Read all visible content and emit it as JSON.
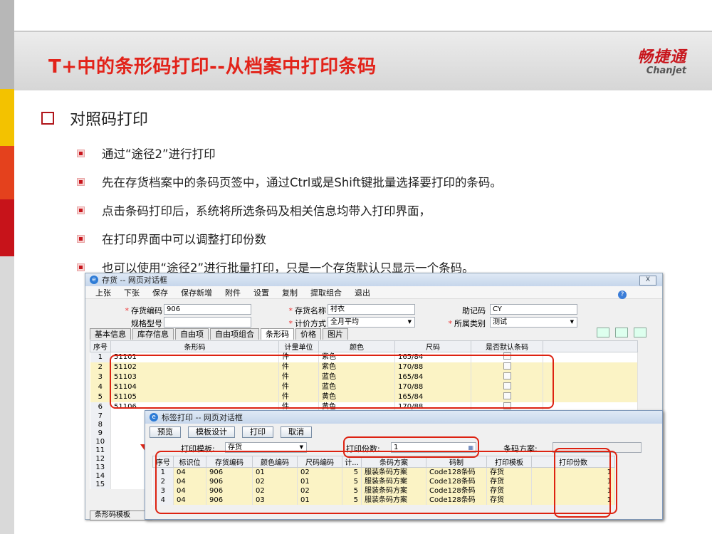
{
  "slide": {
    "title": "T+中的条形码打印--从档案中打印条码",
    "logo_cn": "畅捷通",
    "logo_en": "Chanjet",
    "heading": "对照码打印",
    "bullets": [
      "通过“途径2”进行打印",
      "先在存货档案中的条码页签中，通过Ctrl或是Shift键批量选择要打印的条码。",
      "点击条码打印后，系统将所选条码及相关信息均带入打印界面，",
      "在打印界面中可以调整打印份数",
      "也可以使用“途径2”进行批量打印，只是一个存货默认只显示一个条码。"
    ],
    "accent": "#e2231a"
  },
  "win1": {
    "title": "存货 -- 网页对话框",
    "close": "X",
    "menu": [
      "上张",
      "下张",
      "保存",
      "保存新增",
      "附件",
      "设置",
      "复制",
      "提取组合",
      "退出"
    ],
    "help": "?",
    "form": {
      "code_label": "存货编码",
      "code_value": "906",
      "name_label": "存货名称",
      "name_value": "衬衣",
      "mnemonic_label": "助记码",
      "mnemonic_value": "CY",
      "spec_label": "规格型号",
      "spec_value": "",
      "valuation_label": "计价方式",
      "valuation_value": "全月平均",
      "category_label": "所属类别",
      "category_value": "测试"
    },
    "tabs": [
      "基本信息",
      "库存信息",
      "自由项",
      "自由项组合",
      "条形码",
      "价格",
      "图片"
    ],
    "headers": [
      "序号",
      "条形码",
      "计量单位",
      "颜色",
      "尺码",
      "是否默认条码"
    ],
    "rows": [
      {
        "no": "1",
        "code": "51101",
        "unit": "件",
        "color": "紫色",
        "size": "165/84"
      },
      {
        "no": "2",
        "code": "51102",
        "unit": "件",
        "color": "紫色",
        "size": "170/88"
      },
      {
        "no": "3",
        "code": "51103",
        "unit": "件",
        "color": "蓝色",
        "size": "165/84"
      },
      {
        "no": "4",
        "code": "51104",
        "unit": "件",
        "color": "蓝色",
        "size": "170/88"
      },
      {
        "no": "5",
        "code": "51105",
        "unit": "件",
        "color": "黄色",
        "size": "165/84"
      },
      {
        "no": "6",
        "code": "51106",
        "unit": "件",
        "color": "黄色",
        "size": "170/88"
      },
      {
        "no": "7",
        "code": "",
        "unit": "",
        "color": "",
        "size": ""
      },
      {
        "no": "8",
        "code": "",
        "unit": "",
        "color": "",
        "size": ""
      },
      {
        "no": "9",
        "code": "",
        "unit": "",
        "color": "",
        "size": ""
      },
      {
        "no": "10",
        "code": "",
        "unit": "",
        "color": "",
        "size": ""
      },
      {
        "no": "11",
        "code": "",
        "unit": "",
        "color": "",
        "size": ""
      },
      {
        "no": "12",
        "code": "",
        "unit": "",
        "color": "",
        "size": ""
      },
      {
        "no": "13",
        "code": "",
        "unit": "",
        "color": "",
        "size": ""
      },
      {
        "no": "14",
        "code": "",
        "unit": "",
        "color": "",
        "size": ""
      },
      {
        "no": "15",
        "code": "",
        "unit": "",
        "color": "",
        "size": ""
      }
    ],
    "side_button": "条形码模板"
  },
  "win2": {
    "title": "标签打印 -- 网页对话框",
    "buttons": [
      "预览",
      "模板设计",
      "打印",
      "取消"
    ],
    "template_label": "打印模板:",
    "template_value": "存货",
    "copies_label": "打印份数:",
    "copies_value": "1",
    "scheme_label": "条码方案:",
    "headers": [
      "序号",
      "标识位",
      "存货编码",
      "颜色编码",
      "尺码编码",
      "计...",
      "条码方案",
      "码制",
      "打印模板",
      "打印份数"
    ],
    "rows": [
      {
        "no": "1",
        "flag": "04",
        "inv": "906",
        "color": "01",
        "size": "02",
        "cnt": "5",
        "scheme": "服装条码方案",
        "sym": "Code128条码",
        "tpl": "存货",
        "copies": "1"
      },
      {
        "no": "2",
        "flag": "04",
        "inv": "906",
        "color": "02",
        "size": "01",
        "cnt": "5",
        "scheme": "服装条码方案",
        "sym": "Code128条码",
        "tpl": "存货",
        "copies": "1"
      },
      {
        "no": "3",
        "flag": "04",
        "inv": "906",
        "color": "02",
        "size": "02",
        "cnt": "5",
        "scheme": "服装条码方案",
        "sym": "Code128条码",
        "tpl": "存货",
        "copies": "1"
      },
      {
        "no": "4",
        "flag": "04",
        "inv": "906",
        "color": "03",
        "size": "01",
        "cnt": "5",
        "scheme": "服装条码方案",
        "sym": "Code128条码",
        "tpl": "存货",
        "copies": "1"
      }
    ]
  }
}
